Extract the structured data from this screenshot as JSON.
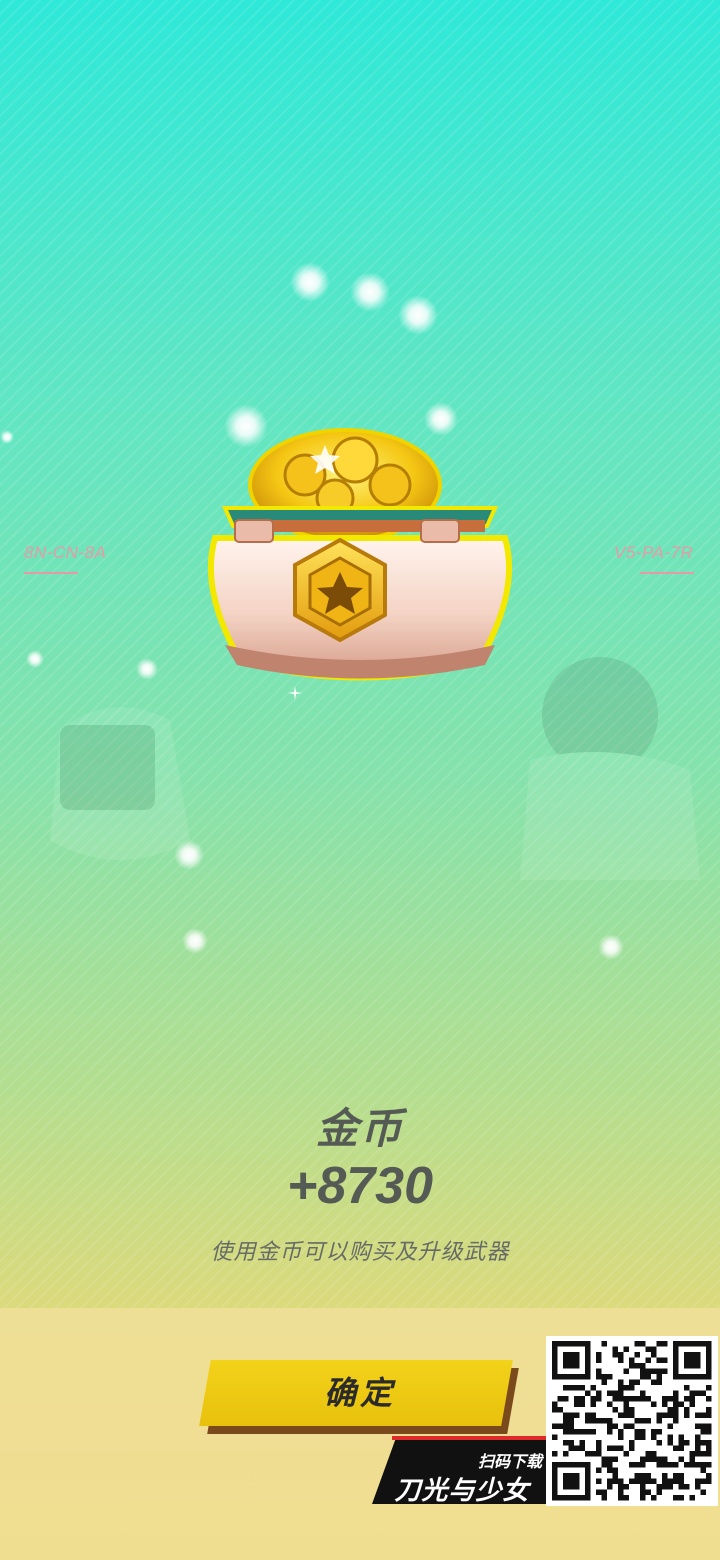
{
  "left_code": "8N-CN-8A",
  "right_code": "V5-PA-7R",
  "reward": {
    "title": "金币",
    "amount": "+8730",
    "description": "使用金币可以购买及升级武器"
  },
  "confirm_label": "确定",
  "promo": {
    "top_text": "扫码下载",
    "game_name": "刀光与少女"
  },
  "colors": {
    "accent_yellow": "#f0cf17",
    "text_dark": "#555a55",
    "code_pink": "#e69aa6"
  },
  "icons": [
    "gold-pot-icon",
    "star-emblem-icon",
    "qr-code-icon"
  ]
}
